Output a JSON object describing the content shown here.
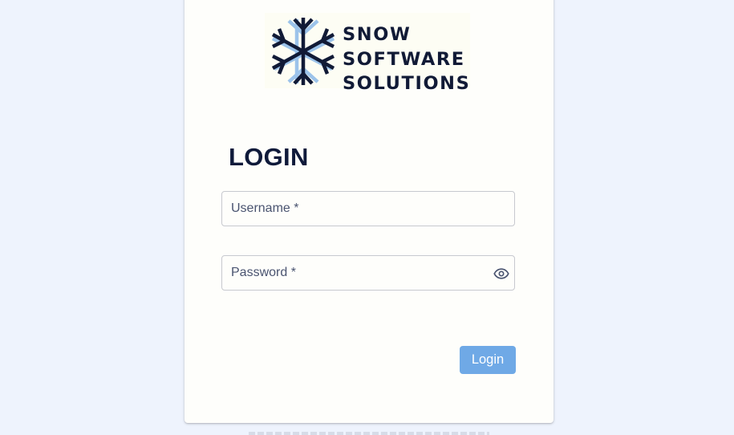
{
  "logo": {
    "lines": [
      "SNOW",
      "SOFTWARE",
      "SOLUTIONS"
    ],
    "icon": "snowflake-icon",
    "colors": {
      "dark": "#111a36",
      "light": "#9cc3ea"
    }
  },
  "login": {
    "title": "LOGIN",
    "username": {
      "placeholder": "Username *",
      "value": ""
    },
    "password": {
      "placeholder": "Password *",
      "value": "",
      "toggle_icon": "eye-icon"
    },
    "button_label": "Login",
    "button_color": "#6fa9e6"
  },
  "colors": {
    "background": "#eef3fd",
    "card": "#fefefb",
    "title": "#0f1a3a"
  }
}
